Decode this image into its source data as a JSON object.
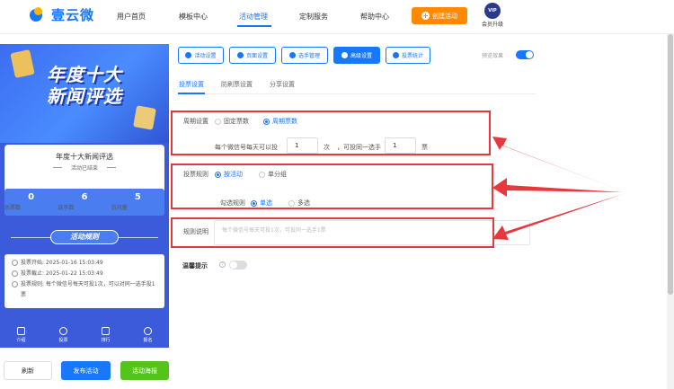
{
  "header": {
    "brand": "壹云微",
    "nav": [
      "用户首页",
      "模板中心",
      "活动管理",
      "定制服务",
      "帮助中心"
    ],
    "active_nav": "活动管理",
    "create_button": "创建活动",
    "vip_badge": "VIP",
    "vip_label": "会员升级"
  },
  "preview": {
    "banner_title_line1": "年度十大",
    "banner_title_line2": "新闻评选",
    "card_title": "年度十大新闻评选",
    "card_status": "活动已结束",
    "stats": [
      {
        "value": "0",
        "label": "总票数"
      },
      {
        "value": "6",
        "label": "选手数"
      },
      {
        "value": "5",
        "label": "访问量"
      }
    ],
    "rules_title": "活动规则",
    "info": [
      "投票开始: 2025-01-16 15:03:49",
      "投票截止: 2025-01-22 15:03:49",
      "投票规则: 每个微信号每天可投1次，可以对同一选手投1票"
    ],
    "tabs": [
      "介绍",
      "投票",
      "排行",
      "报名"
    ]
  },
  "bottom_buttons": {
    "refresh": "刷新",
    "publish": "发布活动",
    "poster": "活动海报"
  },
  "toolbar": {
    "buttons": [
      "活动设置",
      "页面设置",
      "选手管理",
      "高级设置",
      "投票统计"
    ],
    "active": "高级设置",
    "preview_label": "预览效果",
    "preview_on": true
  },
  "subtabs": {
    "items": [
      "投票设置",
      "防刷票设置",
      "分享设置"
    ],
    "active": "投票设置"
  },
  "form": {
    "period_label": "周期设置",
    "period_options": [
      "固定票数",
      "周期票数"
    ],
    "period_selected": "周期票数",
    "daily_prefix": "每个微信号每天可以投",
    "daily_value": "1",
    "daily_unit": "次",
    "same_player_prefix": "，可投同一选手",
    "same_player_value": "1",
    "same_player_unit": "票",
    "rule_label": "投票规则",
    "rule_options": [
      "按活动",
      "单分组"
    ],
    "rule_selected": "按活动",
    "check_label": "勾选规则",
    "check_options": [
      "单选",
      "多选"
    ],
    "check_selected": "单选",
    "explain_label": "规则说明",
    "explain_placeholder": "每个微信号每天可投1次，可投同一选手1票",
    "tip_label": "温馨提示",
    "tip_help": "?",
    "tip_on": false
  },
  "colors": {
    "primary": "#1677ff",
    "orange": "#ff8a00",
    "green": "#52c41a",
    "highlight_red": "#e8383d"
  }
}
